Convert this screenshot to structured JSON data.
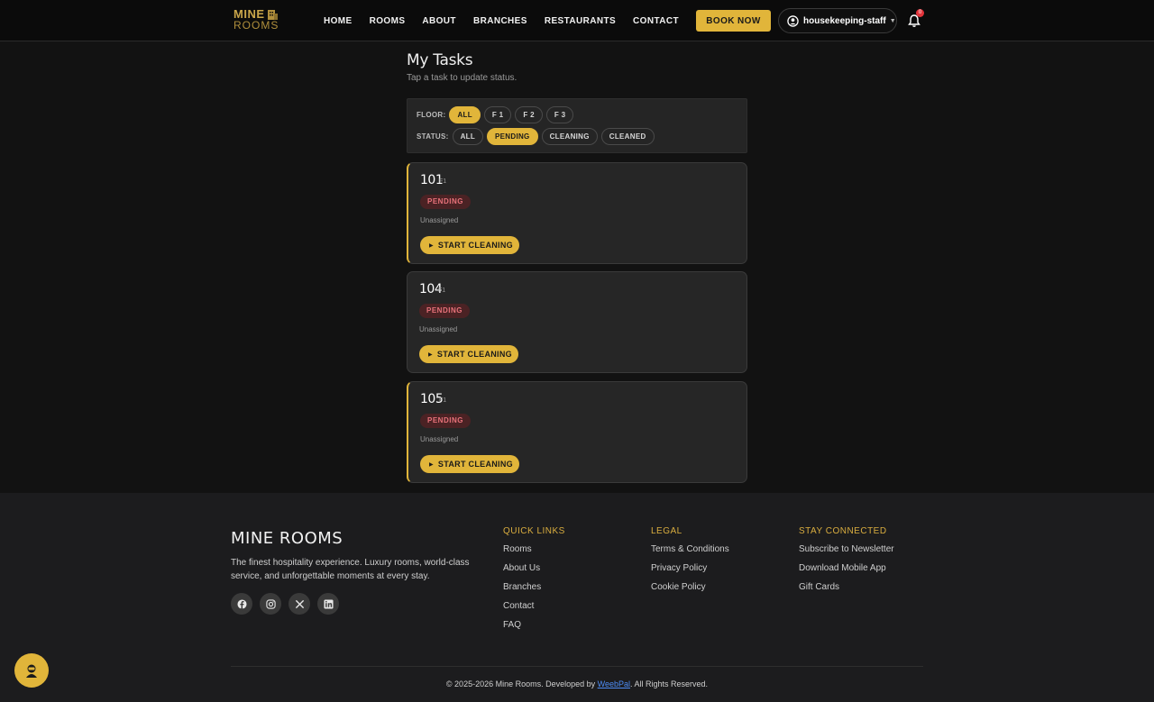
{
  "brand": {
    "logo_line1": "MINE",
    "logo_line2": "ROOMS"
  },
  "nav": {
    "items": [
      "HOME",
      "ROOMS",
      "ABOUT",
      "BRANCHES",
      "RESTAURANTS",
      "CONTACT"
    ],
    "book_label": "BOOK NOW",
    "user": "housekeeping-staff",
    "notif_count": "0"
  },
  "page": {
    "title": "My Tasks",
    "subtitle": "Tap a task to update status."
  },
  "filters": {
    "floor_label": "FLOOR:",
    "floor_options": [
      "ALL",
      "F 1",
      "F 2",
      "F 3"
    ],
    "status_label": "STATUS:",
    "status_options": [
      "ALL",
      "PENDING",
      "CLEANING",
      "CLEANED"
    ]
  },
  "tasks": [
    {
      "room": "101",
      "floor": "F1",
      "status": "PENDING",
      "assignee": "Unassigned",
      "action": "START CLEANING"
    },
    {
      "room": "104",
      "floor": "F1",
      "status": "PENDING",
      "assignee": "Unassigned",
      "action": "START CLEANING"
    },
    {
      "room": "105",
      "floor": "F1",
      "status": "PENDING",
      "assignee": "Unassigned",
      "action": "START CLEANING"
    }
  ],
  "footer": {
    "brand": "MINE ROOMS",
    "description": "The finest hospitality experience. Luxury rooms, world-class service, and unforgettable moments at every stay.",
    "quick_links": {
      "title": "QUICK LINKS",
      "items": [
        "Rooms",
        "About Us",
        "Branches",
        "Contact",
        "FAQ"
      ]
    },
    "legal": {
      "title": "LEGAL",
      "items": [
        "Terms & Conditions",
        "Privacy Policy",
        "Cookie Policy"
      ]
    },
    "stay": {
      "title": "STAY CONNECTED",
      "items": [
        "Subscribe to Newsletter",
        "Download Mobile App",
        "Gift Cards"
      ]
    },
    "copyright_pre": "© 2025-2026 Mine Rooms. Developed by ",
    "copyright_link": "WeebPal",
    "copyright_post": ". All Rights Reserved."
  },
  "colors": {
    "accent": "#e1b53a",
    "badge_bg": "#4b2224",
    "badge_text": "#e8727a",
    "link": "#4d8cf5"
  }
}
